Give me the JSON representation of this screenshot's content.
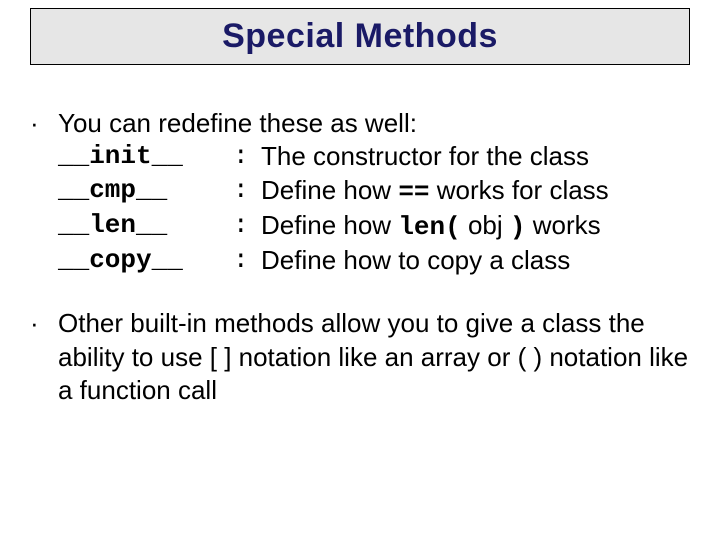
{
  "title": "Special Methods",
  "bullet1": {
    "intro": "You can redefine these as well:",
    "methods": {
      "init": {
        "name": "__init__",
        "colon": ":",
        "desc": "The constructor for the class"
      },
      "cmp": {
        "name": "__cmp__",
        "colon": ":",
        "desc_pre": "Define how ",
        "op": "==",
        "desc_post": " works for class"
      },
      "len": {
        "name": "__len__",
        "colon": ":",
        "desc_pre": "Define how ",
        "fn_open": "len(",
        "arg": " obj ",
        "fn_close": ")",
        "desc_post": " works"
      },
      "copy": {
        "name": "__copy__",
        "colon": ":",
        "desc": "Define how to copy a class"
      }
    }
  },
  "bullet2": "Other built-in methods allow you to give a class the ability to use [ ] notation like an array or ( ) notation like a function call",
  "bullet_glyph": "·"
}
